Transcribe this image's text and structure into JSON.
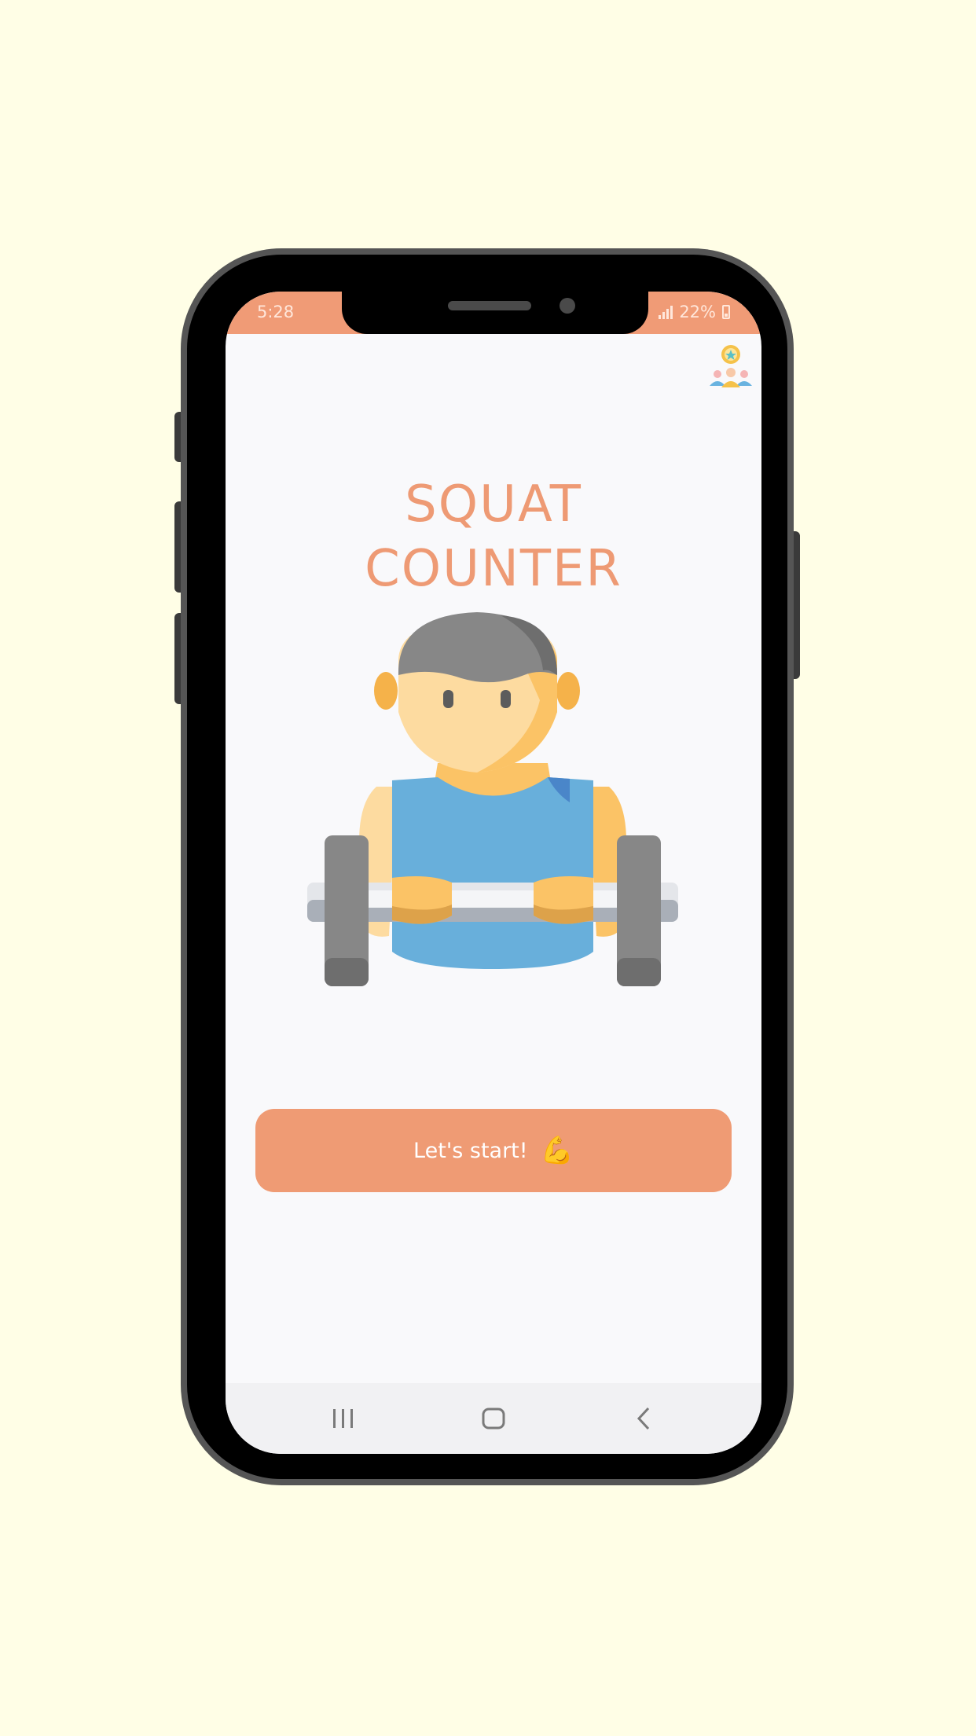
{
  "status_bar": {
    "time": "5:28",
    "battery": "22%"
  },
  "main": {
    "title_line1": "SQUAT",
    "title_line2": "COUNTER",
    "start_label": "Let's start!",
    "start_emoji": "💪"
  },
  "icons": {
    "leaderboard": "leaderboard-icon",
    "hero": "weightlifter-illustration",
    "nav_recent": "recent-apps-icon",
    "nav_home": "home-icon",
    "nav_back": "back-icon"
  },
  "colors": {
    "background": "#FFFEE6",
    "accent": "#EF9B74",
    "screen": "#F9F9FB"
  }
}
